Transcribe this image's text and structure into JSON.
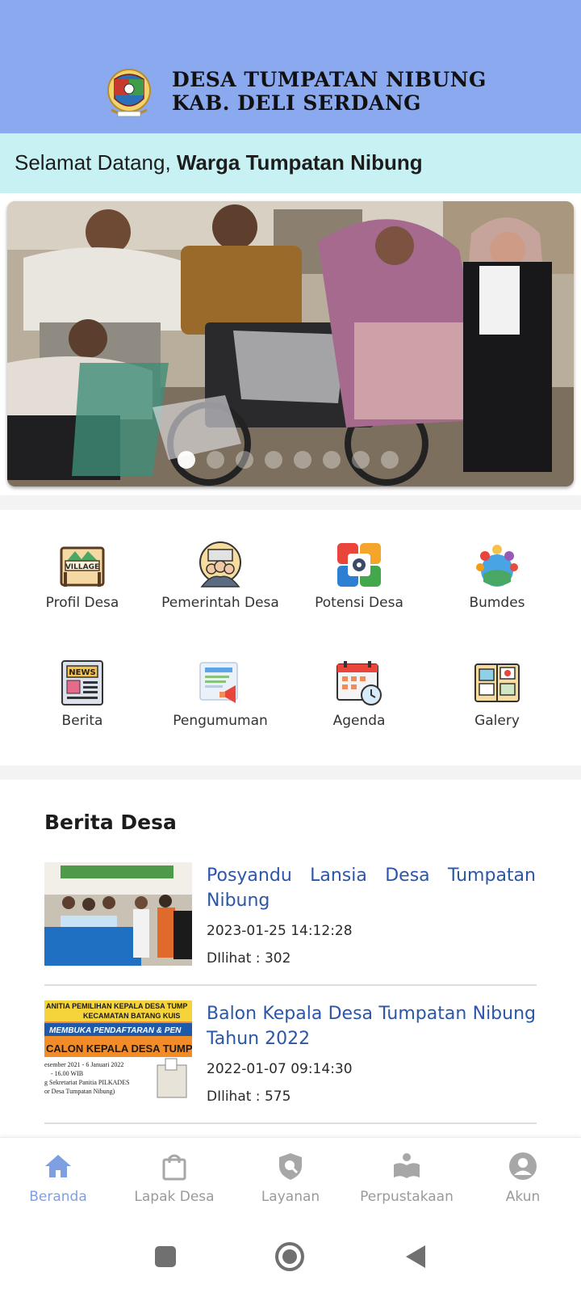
{
  "header": {
    "title_line1": "DESA TUMPATAN NIBUNG",
    "title_line2": "KAB. DELI SERDANG",
    "logo_icon": "village-emblem-icon"
  },
  "welcome": {
    "prefix": "Selamat Datang, ",
    "name": "Warga Tumpatan Nibung"
  },
  "carousel": {
    "slide_count": 8,
    "active_index": 0
  },
  "menu": {
    "items": [
      {
        "label": "Profil Desa",
        "icon": "village-sign-icon"
      },
      {
        "label": "Pemerintah Desa",
        "icon": "government-people-icon"
      },
      {
        "label": "Potensi Desa",
        "icon": "potential-gear-icon"
      },
      {
        "label": "Bumdes",
        "icon": "community-group-icon"
      },
      {
        "label": "Berita",
        "icon": "newspaper-icon"
      },
      {
        "label": "Pengumuman",
        "icon": "announcement-icon"
      },
      {
        "label": "Agenda",
        "icon": "calendar-clock-icon"
      },
      {
        "label": "Galery",
        "icon": "photo-album-icon"
      }
    ]
  },
  "news": {
    "section_title": "Berita Desa",
    "items": [
      {
        "title": "Posyandu Lansia Desa Tumpatan Nibung",
        "date": "2023-01-25 14:12:28",
        "views": "DIlihat : 302"
      },
      {
        "title": "Balon Kepala Desa Tumpatan Nibung Tahun 2022",
        "date": "2022-01-07 09:14:30",
        "views": "DIlihat : 575",
        "thumb_text": {
          "line1": "ANITIA PEMILIHAN KEPALA DESA TUMP",
          "line2": "KECAMATAN BATANG KUIS",
          "line3": "MEMBUKA PENDAFTARAN & PEN",
          "line4": "CALON KEPALA DESA TUMPAT",
          "line5": "esember 2021 - 6 Januari  2022",
          "line6": "- 16.00 WIB",
          "line7": "g Sekretariat Panitia PILKADES",
          "line8": "or Desa Tumpatan Nibung)"
        }
      }
    ]
  },
  "bottom_nav": {
    "items": [
      {
        "label": "Beranda",
        "icon": "home-icon",
        "active": true
      },
      {
        "label": "Lapak Desa",
        "icon": "shopping-bag-icon",
        "active": false
      },
      {
        "label": "Layanan",
        "icon": "service-shield-icon",
        "active": false
      },
      {
        "label": "Perpustakaan",
        "icon": "reading-book-icon",
        "active": false
      },
      {
        "label": "Akun",
        "icon": "account-icon",
        "active": false
      }
    ]
  },
  "colors": {
    "header_bg": "#8ba9ef",
    "welcome_bg": "#c8f1f3",
    "news_title": "#2c56a8",
    "nav_active": "#7f9fe3",
    "nav_inactive": "#9a9a9a"
  }
}
